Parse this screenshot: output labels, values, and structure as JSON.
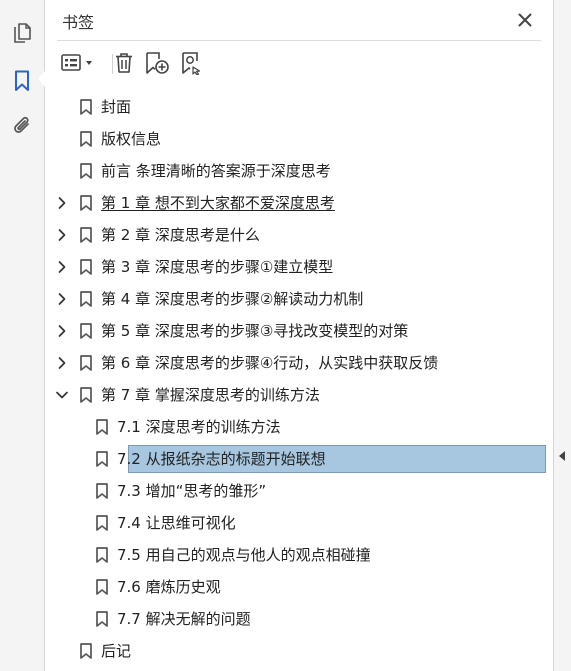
{
  "panel": {
    "title": "书签"
  },
  "left_rail": {
    "buttons": [
      "pages-icon",
      "bookmark-icon",
      "attachment-icon"
    ],
    "active": "bookmark-icon"
  },
  "toolbar": {
    "buttons": [
      "options-menu-icon",
      "delete-bookmark-icon",
      "new-bookmark-icon",
      "bookmark-search-icon"
    ]
  },
  "colors": {
    "accent": "#2b64c8",
    "selection": "#a7c7e0"
  },
  "bookmarks": [
    {
      "label": "封面",
      "level": 0,
      "expandable": false
    },
    {
      "label": "版权信息",
      "level": 0,
      "expandable": false
    },
    {
      "label": "前言 条理清晰的答案源于深度思考",
      "level": 0,
      "expandable": false
    },
    {
      "label": "第 1 章 想不到大家都不爱深度思考",
      "level": 0,
      "expandable": true,
      "expanded": false,
      "hovered": true
    },
    {
      "label": "第 2 章 深度思考是什么",
      "level": 0,
      "expandable": true,
      "expanded": false
    },
    {
      "label": "第 3 章 深度思考的步骤①建立模型",
      "level": 0,
      "expandable": true,
      "expanded": false
    },
    {
      "label": "第 4 章 深度思考的步骤②解读动力机制",
      "level": 0,
      "expandable": true,
      "expanded": false
    },
    {
      "label": "第 5 章 深度思考的步骤③寻找改变模型的对策",
      "level": 0,
      "expandable": true,
      "expanded": false
    },
    {
      "label": "第 6 章 深度思考的步骤④行动，从实践中获取反馈",
      "level": 0,
      "expandable": true,
      "expanded": false
    },
    {
      "label": "第 7 章 掌握深度思考的训练方法",
      "level": 0,
      "expandable": true,
      "expanded": true
    },
    {
      "label": "7.1 深度思考的训练方法",
      "level": 1,
      "expandable": false
    },
    {
      "label": "7.2 从报纸杂志的标题开始联想",
      "level": 1,
      "expandable": false,
      "selected": true
    },
    {
      "label": "7.3 增加“思考的雏形”",
      "level": 1,
      "expandable": false
    },
    {
      "label": "7.4 让思维可视化",
      "level": 1,
      "expandable": false
    },
    {
      "label": "7.5 用自己的观点与他人的观点相碰撞",
      "level": 1,
      "expandable": false
    },
    {
      "label": "7.6 磨炼历史观",
      "level": 1,
      "expandable": false
    },
    {
      "label": "7.7 解决无解的问题",
      "level": 1,
      "expandable": false
    },
    {
      "label": "后记",
      "level": 0,
      "expandable": false
    }
  ]
}
